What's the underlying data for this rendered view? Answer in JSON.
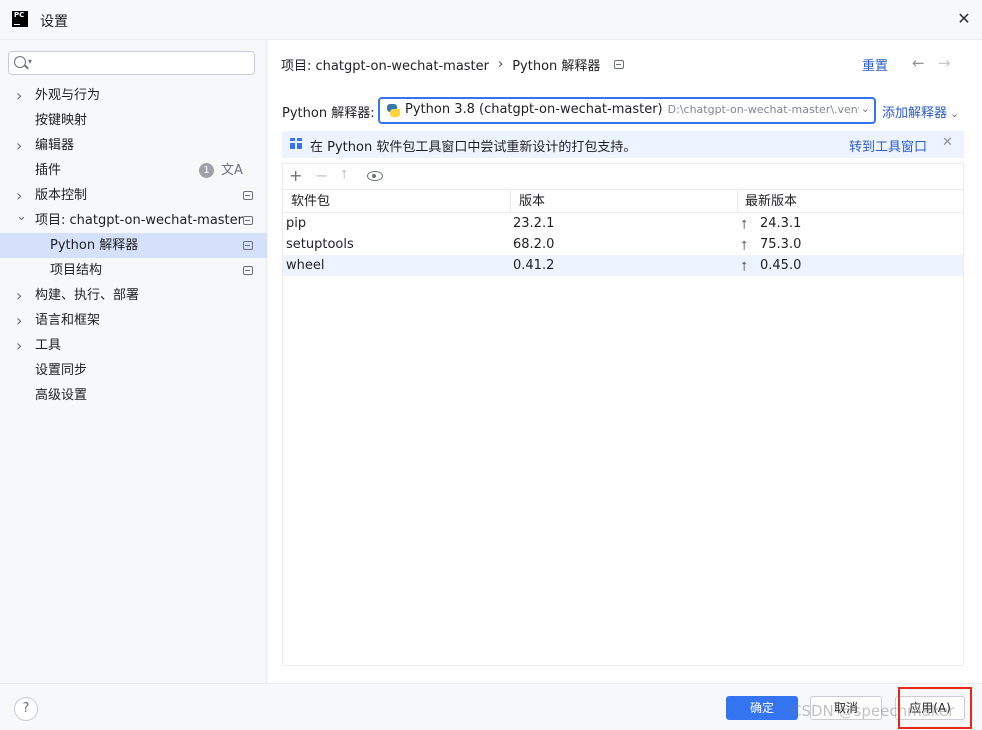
{
  "window": {
    "logo_text": "PC",
    "title": "设置",
    "close_glyph": "✕"
  },
  "sidebar": {
    "search": {
      "value": "",
      "placeholder": ""
    },
    "items": [
      {
        "label": "外观与行为",
        "chevron": "right"
      },
      {
        "label": "按键映射",
        "chevron": "none"
      },
      {
        "label": "编辑器",
        "chevron": "right"
      },
      {
        "label": "插件",
        "chevron": "none",
        "badge": "1",
        "extra_icon": "translate-icon",
        "extra_glyph": "文A"
      },
      {
        "label": "版本控制",
        "chevron": "right",
        "project_icon": true
      },
      {
        "label": "项目: chatgpt-on-wechat-master",
        "chevron": "down",
        "project_icon": true
      },
      {
        "label": "Python 解释器",
        "level": 2,
        "selected": true,
        "project_icon": true
      },
      {
        "label": "项目结构",
        "level": 2,
        "project_icon": true
      },
      {
        "label": "构建、执行、部署",
        "chevron": "right"
      },
      {
        "label": "语言和框架",
        "chevron": "right"
      },
      {
        "label": "工具",
        "chevron": "right"
      },
      {
        "label": "设置同步",
        "chevron": "none"
      },
      {
        "label": "高级设置",
        "chevron": "none"
      }
    ]
  },
  "header": {
    "breadcrumb": [
      "项目: chatgpt-on-wechat-master",
      "Python 解释器"
    ],
    "breadcrumb_sep": "›",
    "reset_label": "重置",
    "back_glyph": "←",
    "forward_glyph": "→"
  },
  "interpreter": {
    "label": "Python 解释器:",
    "name": "Python 3.8 (chatgpt-on-wechat-master)",
    "path": "D:\\chatgpt-on-wechat-master\\.venv\\",
    "caret": "⌄",
    "add_label": "添加解释器",
    "add_caret": "⌄"
  },
  "notice": {
    "text": "在 Python 软件包工具窗口中尝试重新设计的打包支持。",
    "link_label": "转到工具窗口",
    "close_glyph": "✕"
  },
  "toolbar": {
    "add_glyph": "+",
    "remove_glyph": "−",
    "upgrade_glyph": "⭡"
  },
  "packages": {
    "columns": [
      "软件包",
      "版本",
      "最新版本"
    ],
    "upgrade_glyph": "⭡",
    "rows": [
      {
        "name": "pip",
        "version": "23.2.1",
        "latest": "24.3.1"
      },
      {
        "name": "setuptools",
        "version": "68.2.0",
        "latest": "75.3.0"
      },
      {
        "name": "wheel",
        "version": "0.41.2",
        "latest": "0.45.0"
      }
    ]
  },
  "footer": {
    "help_glyph": "?",
    "ok_label": "确定",
    "cancel_label": "取消",
    "apply_label": "应用(A)",
    "watermark": "CSDN @speechmaker"
  },
  "colors": {
    "accent": "#3574f0",
    "link": "#2c5dc0",
    "selection": "#d5e1fa",
    "highlight_box": "#e8261a"
  }
}
